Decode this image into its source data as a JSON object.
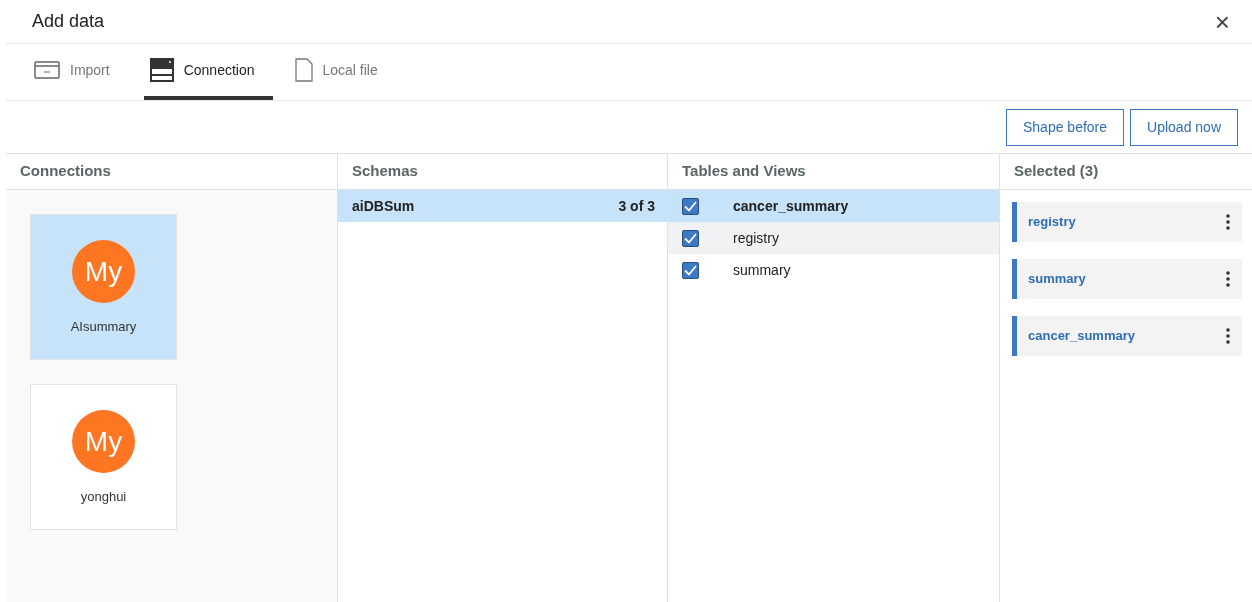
{
  "window": {
    "title": "Add data",
    "close": "×"
  },
  "tabs": [
    {
      "label": "Import",
      "kind": "import",
      "selected": false
    },
    {
      "label": "Connection",
      "kind": "connection",
      "selected": true
    },
    {
      "label": "Local file",
      "kind": "file",
      "selected": false
    }
  ],
  "buttons": [
    "Shape before",
    "Upload now"
  ],
  "connections": {
    "title": "Connections",
    "items": [
      {
        "initials": "My",
        "name": "AIsummary",
        "selected": true
      },
      {
        "initials": "My",
        "name": "yonghui",
        "selected": false
      }
    ]
  },
  "schemas": {
    "title": "Schemas",
    "items": [
      {
        "name": "aiDBSum",
        "count": "3 of 3",
        "selected": true
      }
    ]
  },
  "tables": {
    "title": "Tables and Views",
    "items": [
      {
        "name": "cancer_summary",
        "checked": true,
        "selected": true,
        "hovered": false
      },
      {
        "name": "registry",
        "checked": true,
        "selected": false,
        "hovered": true
      },
      {
        "name": "summary",
        "checked": true,
        "selected": false,
        "hovered": false
      }
    ]
  },
  "selected": {
    "title": "Selected (3)",
    "items": [
      "registry",
      "summary",
      "cancer_summary"
    ]
  }
}
